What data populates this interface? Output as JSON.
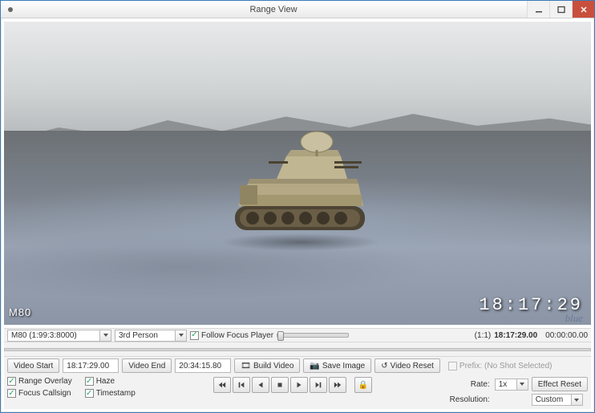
{
  "window": {
    "title": "Range View",
    "modified_indicator": "*"
  },
  "viewport": {
    "entity_label": "M80",
    "timestamp_overlay": "18:17:29",
    "watermark": "blue"
  },
  "status": {
    "entity_dropdown": "M80 (1:99:3:8000)",
    "camera_dropdown": "3rd Person",
    "follow_label": "Follow Focus Player",
    "ratio": "(1:1)",
    "current_time": "18:17:29.00",
    "elapsed": "00:00:00.00"
  },
  "video": {
    "start_label": "Video Start",
    "start_value": "18:17:29.00",
    "end_label": "Video End",
    "end_value": "20:34:15.80",
    "build_label": "Build Video",
    "save_image_label": "Save Image",
    "reset_label": "Video Reset",
    "prefix_label": "Prefix: (No Shot Selected)"
  },
  "checks": {
    "range_overlay": "Range Overlay",
    "haze": "Haze",
    "focus_callsign": "Focus Callsign",
    "timestamp": "Timestamp"
  },
  "right": {
    "rate_label": "Rate:",
    "rate_value": "1x",
    "effect_reset": "Effect Reset",
    "resolution_label": "Resolution:",
    "resolution_value": "Custom"
  },
  "icons": {
    "camera": "📷",
    "reset": "↺",
    "lock": "🔒"
  }
}
